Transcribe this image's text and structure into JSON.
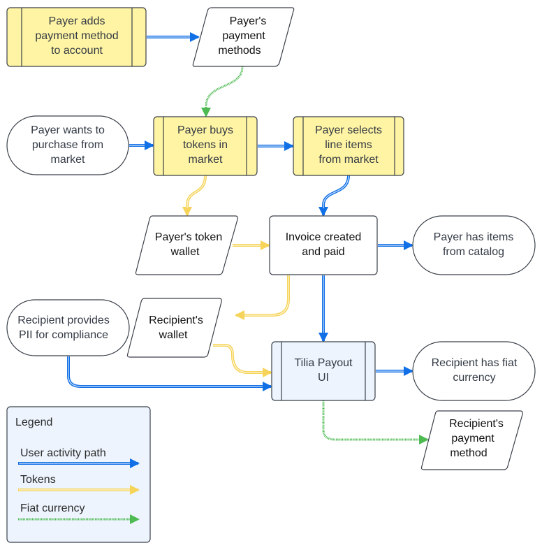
{
  "colors": {
    "process_fill": "#fff4a3",
    "ui_fill": "#edf4fd",
    "terminal_fill": "#ffffff",
    "data_fill": "#ffffff",
    "stroke": "#3a414a",
    "user_path": "#1170e6",
    "tokens": "#f6d45a",
    "fiat": "#4dbb52"
  },
  "nodes": {
    "payer_adds_payment": {
      "lines": [
        "Payer adds",
        "payment method",
        "to account"
      ],
      "shape": "process"
    },
    "payer_payment_methods": {
      "lines": [
        "Payer's",
        "payment",
        "methods"
      ],
      "shape": "data"
    },
    "payer_wants_purchase": {
      "lines": [
        "Payer wants to",
        "purchase from",
        "market"
      ],
      "shape": "terminal"
    },
    "payer_buys_tokens": {
      "lines": [
        "Payer buys",
        "tokens in",
        "market"
      ],
      "shape": "process"
    },
    "payer_selects_items": {
      "lines": [
        "Payer selects",
        "line items",
        "from market"
      ],
      "shape": "process"
    },
    "payer_token_wallet": {
      "lines": [
        "Payer's token",
        "wallet"
      ],
      "shape": "data"
    },
    "invoice_created": {
      "lines": [
        "Invoice created",
        "and paid"
      ],
      "shape": "rect"
    },
    "payer_has_items": {
      "lines": [
        "Payer has items",
        "from catalog"
      ],
      "shape": "terminal"
    },
    "recipient_provides_pii": {
      "lines": [
        "Recipient provides",
        "PII for compliance"
      ],
      "shape": "terminal"
    },
    "recipient_wallet": {
      "lines": [
        "Recipient's",
        "wallet"
      ],
      "shape": "data"
    },
    "tilia_payout_ui": {
      "lines": [
        "Tilia Payout",
        "UI"
      ],
      "shape": "process-ui"
    },
    "recipient_has_fiat": {
      "lines": [
        "Recipient has fiat",
        "currency"
      ],
      "shape": "terminal"
    },
    "recipient_payment_method": {
      "lines": [
        "Recipient's",
        "payment",
        "method"
      ],
      "shape": "data"
    }
  },
  "edges": [
    {
      "from": "payer_adds_payment",
      "to": "payer_payment_methods",
      "type": "user_path"
    },
    {
      "from": "payer_payment_methods",
      "to": "payer_buys_tokens",
      "type": "fiat"
    },
    {
      "from": "payer_wants_purchase",
      "to": "payer_buys_tokens",
      "type": "user_path"
    },
    {
      "from": "payer_buys_tokens",
      "to": "payer_selects_items",
      "type": "user_path"
    },
    {
      "from": "payer_buys_tokens",
      "to": "payer_token_wallet",
      "type": "tokens"
    },
    {
      "from": "payer_selects_items",
      "to": "invoice_created",
      "type": "user_path"
    },
    {
      "from": "payer_token_wallet",
      "to": "invoice_created",
      "type": "tokens"
    },
    {
      "from": "invoice_created",
      "to": "payer_has_items",
      "type": "user_path"
    },
    {
      "from": "invoice_created",
      "to": "recipient_wallet",
      "type": "tokens"
    },
    {
      "from": "invoice_created",
      "to": "tilia_payout_ui",
      "type": "user_path"
    },
    {
      "from": "recipient_wallet",
      "to": "tilia_payout_ui",
      "type": "tokens"
    },
    {
      "from": "recipient_provides_pii",
      "to": "tilia_payout_ui",
      "type": "user_path"
    },
    {
      "from": "tilia_payout_ui",
      "to": "recipient_has_fiat",
      "type": "user_path"
    },
    {
      "from": "tilia_payout_ui",
      "to": "recipient_payment_method",
      "type": "fiat"
    }
  ],
  "legend": {
    "title": "Legend",
    "items": [
      {
        "label": "User activity path",
        "type": "user_path"
      },
      {
        "label": "Tokens",
        "type": "tokens"
      },
      {
        "label": "Fiat currency",
        "type": "fiat"
      }
    ]
  }
}
